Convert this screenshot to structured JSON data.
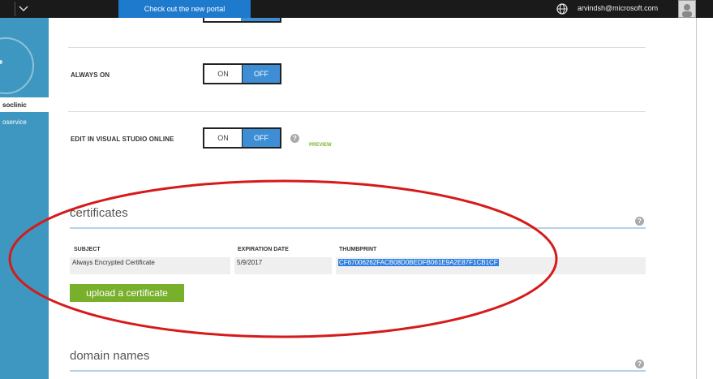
{
  "topbar": {
    "portal_label": "Check out the new portal",
    "user_email": "arvindsh@microsoft.com",
    "icons": [
      "chevron-down-icon",
      "globe-icon",
      "avatar"
    ]
  },
  "sidebar": {
    "active_item": "soclinic",
    "item": "oservice"
  },
  "settings": {
    "always_on": {
      "label": "ALWAYS ON",
      "on": "ON",
      "off": "OFF",
      "selected": "OFF"
    },
    "edit_vso": {
      "label": "EDIT IN VISUAL STUDIO ONLINE",
      "on": "ON",
      "off": "OFF",
      "selected": "OFF",
      "tag": "PREVIEW"
    },
    "help": "?"
  },
  "certificates": {
    "title": "certificates",
    "columns": [
      "SUBJECT",
      "EXPIRATION DATE",
      "THUMBPRINT"
    ],
    "rows": [
      {
        "subject": "Always Encrypted Certificate",
        "expiration": "5/9/2017",
        "thumbprint": "CF67006262FACB08D0BEDFB061E9A2E87F1CB1CF"
      }
    ],
    "upload_label": "upload a certificate"
  },
  "domains": {
    "title": "domain names"
  },
  "colors": {
    "topbar": "#1a1a1a",
    "portal": "#1e7acd",
    "sidebar": "#3e97c0",
    "toggle_off": "#3e8ed6",
    "upload": "#78b02c",
    "annotation": "#d61a1a"
  }
}
